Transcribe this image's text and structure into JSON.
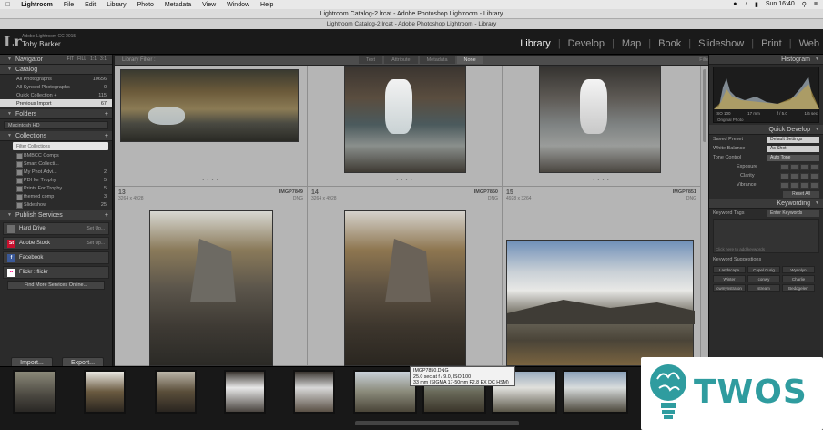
{
  "menubar": {
    "apple": "",
    "items": [
      "Lightroom",
      "File",
      "Edit",
      "Library",
      "Photo",
      "Metadata",
      "View",
      "Window",
      "Help"
    ],
    "clock": "Sun 16:40"
  },
  "window": {
    "title": "Lightroom Catalog-2.lrcat - Adobe Photoshop Lightroom - Library",
    "subtitle": "Lightroom Catalog-2.lrcat - Adobe Photoshop Lightroom - Library"
  },
  "identity": {
    "logo": "Lr",
    "version": "Adobe Lightroom CC 2015",
    "user": "Toby Barker"
  },
  "modules": [
    "Library",
    "Develop",
    "Map",
    "Book",
    "Slideshow",
    "Print",
    "Web"
  ],
  "active_module": "Library",
  "left": {
    "navigator": {
      "title": "Navigator",
      "modes": [
        "FIT",
        "FILL",
        "1:1",
        "3:1"
      ]
    },
    "catalog": {
      "title": "Catalog",
      "items": [
        {
          "label": "All Photographs",
          "count": "10656"
        },
        {
          "label": "All Synced Photographs",
          "count": "0"
        },
        {
          "label": "Quick Collection +",
          "count": "115"
        },
        {
          "label": "Previous Import",
          "count": "67"
        }
      ]
    },
    "folders": {
      "title": "Folders",
      "source": "Macintosh HD"
    },
    "collections": {
      "title": "Collections",
      "filter_placeholder": "Filter Collections",
      "items": [
        {
          "label": "BMBCC Comps",
          "count": ""
        },
        {
          "label": "Smart Collecti...",
          "count": ""
        },
        {
          "label": "My Phot Advi...",
          "count": "2"
        },
        {
          "label": "PDI for Trophy",
          "count": "5"
        },
        {
          "label": "Prints For Trophy",
          "count": "5"
        },
        {
          "label": "themed comp",
          "count": "3"
        },
        {
          "label": "Slideshow",
          "count": "25"
        }
      ]
    },
    "publish": {
      "title": "Publish Services",
      "services": [
        {
          "label": "Hard Drive",
          "action": "Set Up...",
          "icon": "hard-drive-icon",
          "color": "#6e6e6e",
          "glyph": ""
        },
        {
          "label": "Adobe Stock",
          "action": "Set Up...",
          "icon": "adobe-stock-icon",
          "color": "#c8102e",
          "glyph": "St"
        },
        {
          "label": "Facebook",
          "action": "",
          "icon": "facebook-icon",
          "color": "#3b5998",
          "glyph": "f"
        },
        {
          "label": "Flickr : flickr",
          "action": "",
          "icon": "flickr-icon",
          "color": "#ff0084",
          "glyph": "••"
        }
      ],
      "find_more": "Find More Services Online..."
    },
    "import_label": "Import...",
    "export_label": "Export..."
  },
  "filterbar": {
    "title": "Library Filter :",
    "options": [
      "Text",
      "Attribute",
      "Metadata",
      "None"
    ],
    "selected": "None",
    "filter_state": "Filters Off"
  },
  "grid": {
    "cells": [
      {
        "num": "",
        "file": "",
        "dims": "",
        "ext": ""
      },
      {
        "num": "",
        "file": "",
        "dims": "",
        "ext": ""
      },
      {
        "num": "",
        "file": "",
        "dims": "",
        "ext": ""
      },
      {
        "num": "13",
        "file": "IMGP7849",
        "dims": "3264 x 4928",
        "ext": "DNG"
      },
      {
        "num": "14",
        "file": "IMGP7850",
        "dims": "3264 x 4928",
        "ext": "DNG"
      },
      {
        "num": "15",
        "file": "IMGP7851",
        "dims": "4928 x 3264",
        "ext": "DNG"
      }
    ]
  },
  "right": {
    "histogram": {
      "title": "Histogram",
      "iso": "ISO 100",
      "focal": "17 mm",
      "aperture": "f / 5.0",
      "shutter": "1/6 sec",
      "original": "Original Photo"
    },
    "quick_develop": {
      "title": "Quick Develop",
      "saved_preset_label": "Saved Preset",
      "saved_preset_value": "Default Settings",
      "wb_label": "White Balance",
      "wb_value": "As Shot",
      "tone_label": "Tone Control",
      "tone_value": "Auto Tone",
      "exposure_label": "Exposure",
      "clarity_label": "Clarity",
      "vibrance_label": "Vibrance",
      "reset": "Reset All"
    },
    "keywording": {
      "title": "Keywording",
      "tags_label": "Keyword Tags",
      "tags_value": "Enter Keywords",
      "add_placeholder": "Click here to add keywords",
      "suggestions_title": "Keyword Suggestions",
      "suggestions": [
        "Landscape",
        "Capel Curig",
        "Wynnlyn",
        "Winter",
        "conwy",
        "Charlie",
        "cwmynstrafon",
        "stream",
        "Beddgelert"
      ]
    }
  },
  "filmstrip": {
    "tooltip": [
      "IMGP7850.DNG",
      "25.0 sec at f / 9.0, ISO 100",
      "33 mm (SIGMA 17-50mm F2.8 EX DC HSM)"
    ]
  },
  "brand": {
    "text": "TWOS",
    "color": "#2f9c9f"
  }
}
